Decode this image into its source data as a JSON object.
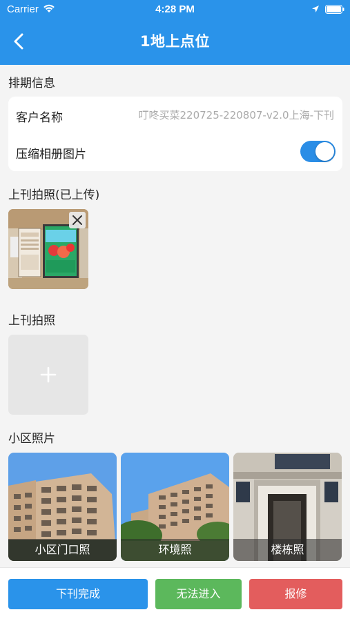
{
  "status_bar": {
    "carrier": "Carrier",
    "time": "4:28 PM"
  },
  "nav": {
    "title": "1地上点位",
    "back_icon": "chevron-left-icon"
  },
  "schedule": {
    "section_title": "排期信息",
    "customer_label": "客户名称",
    "customer_value": "叮咚买菜220725-220807-v2.0上海-下刊",
    "compress_label": "压缩相册图片",
    "compress_enabled": true
  },
  "uploaded": {
    "section_title": "上刊拍照(已上传)",
    "photo_count": 1
  },
  "take_photo": {
    "section_title": "上刊拍照",
    "add_icon": "plus-icon"
  },
  "community": {
    "section_title": "小区照片",
    "photos": [
      {
        "caption": "小区门口照"
      },
      {
        "caption": "环境照"
      },
      {
        "caption": "楼栋照"
      }
    ]
  },
  "actions": {
    "complete": "下刊完成",
    "no_entry": "无法进入",
    "repair": "报修"
  },
  "colors": {
    "primary": "#2a93ea",
    "green": "#5cb85c",
    "red": "#e35d5d",
    "toggle": "#2a8de6"
  }
}
